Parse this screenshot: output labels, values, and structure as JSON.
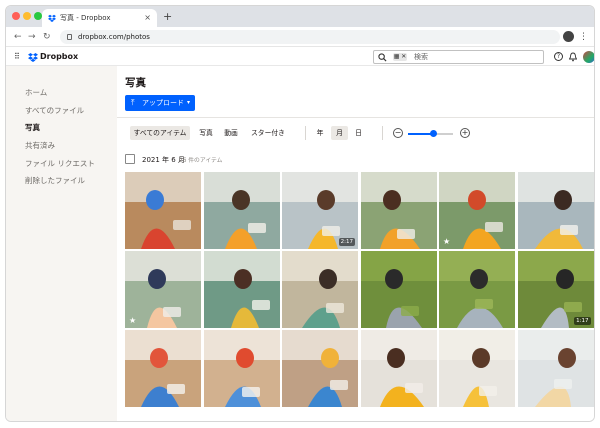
{
  "browser": {
    "tab_title": "写真 - Dropbox",
    "tab_close": "×",
    "new_tab": "+",
    "url": "dropbox.com/photos",
    "colors": {
      "close": "#ff5f57",
      "minimize": "#febc2e",
      "zoom": "#28c840"
    }
  },
  "header": {
    "brand": "Dropbox",
    "search_chip": "▦ ✕",
    "search_placeholder": "検索",
    "help_icon": "?",
    "bell_icon": "🔔",
    "grid_icon": "⠿"
  },
  "sidebar": {
    "items": [
      {
        "label": "ホーム",
        "active": false
      },
      {
        "label": "すべてのファイル",
        "active": false
      },
      {
        "label": "写真",
        "active": true
      },
      {
        "label": "共有済み",
        "active": false
      },
      {
        "label": "ファイル リクエスト",
        "active": false
      },
      {
        "label": "削除したファイル",
        "active": false
      }
    ]
  },
  "main": {
    "title": "写真",
    "upload_label": "アップロード",
    "filters": [
      "すべてのアイテム",
      "写真",
      "動画",
      "スター付き"
    ],
    "active_filter": "すべてのアイテム",
    "periods": [
      "年",
      "月",
      "日"
    ],
    "active_period": "月",
    "zoom_minus": "−",
    "zoom_plus": "+",
    "zoom_level": 0.55,
    "section_title": "2021 年 6 月",
    "section_count": "26 件のアイテム",
    "accent": "#0061fe"
  },
  "photos": [
    {
      "name": "photo-drawing-on-floor",
      "badge": "",
      "star": false
    },
    {
      "name": "photo-boy-on-bench",
      "badge": "",
      "star": false
    },
    {
      "name": "photo-family-on-bench",
      "badge": "2:17",
      "star": false
    },
    {
      "name": "photo-boy-hands-up",
      "badge": "",
      "star": false
    },
    {
      "name": "photo-boy-laughing",
      "badge": "",
      "star": true
    },
    {
      "name": "photo-father-daughter",
      "badge": "",
      "star": false
    },
    {
      "name": "photo-mother-child",
      "badge": "",
      "star": true
    },
    {
      "name": "photo-mother-painting",
      "badge": "",
      "star": false
    },
    {
      "name": "photo-kid-painting-wall",
      "badge": "",
      "star": false
    },
    {
      "name": "photo-dogs-in-grass",
      "badge": "",
      "star": false
    },
    {
      "name": "photo-two-dogs",
      "badge": "",
      "star": false
    },
    {
      "name": "photo-dog-portrait",
      "badge": "1:17",
      "star": false
    },
    {
      "name": "photo-child-drawing",
      "badge": "",
      "star": false
    },
    {
      "name": "photo-drawing-paper",
      "badge": "",
      "star": false
    },
    {
      "name": "photo-drawing-held",
      "badge": "",
      "star": false
    },
    {
      "name": "photo-father-child-yellow",
      "badge": "",
      "star": false
    },
    {
      "name": "photo-father-daughter-couch",
      "badge": "",
      "star": false
    },
    {
      "name": "photo-girl-smiling",
      "badge": "",
      "star": false
    }
  ]
}
